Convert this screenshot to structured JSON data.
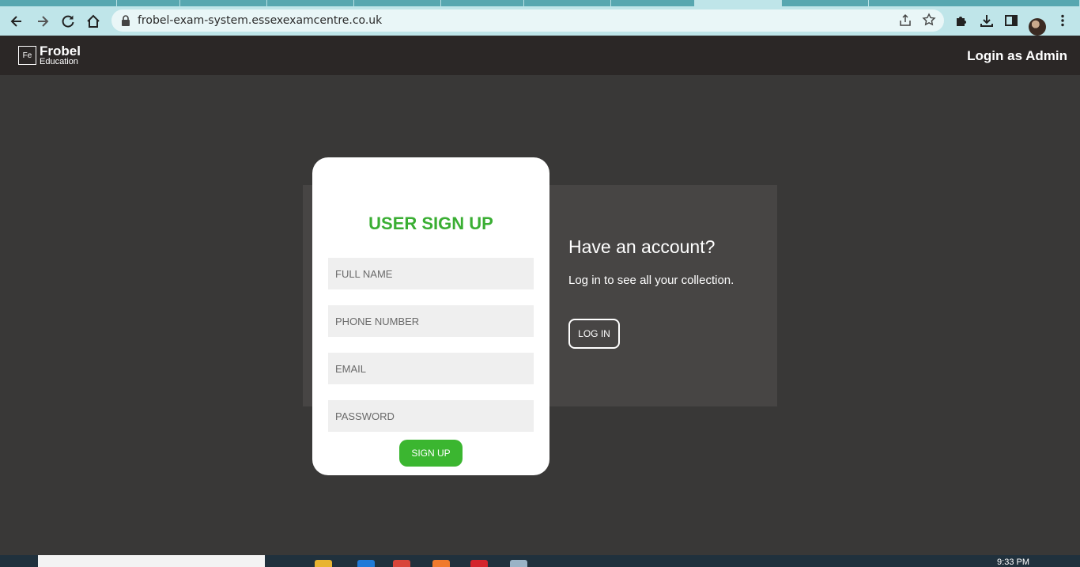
{
  "browser": {
    "url": "frobel-exam-system.essexexamcentre.co.uk"
  },
  "header": {
    "logo_box": "Fe",
    "logo_name": "Frobel",
    "logo_sub": "Education",
    "admin_link": "Login as Admin"
  },
  "signup": {
    "title": "USER SIGN UP",
    "fields": [
      {
        "placeholder": "FULL NAME"
      },
      {
        "placeholder": "PHONE NUMBER"
      },
      {
        "placeholder": "EMAIL"
      },
      {
        "placeholder": "PASSWORD"
      }
    ],
    "button": "SIGN UP",
    "accent_color": "#3bb630"
  },
  "login_panel": {
    "heading": "Have an account?",
    "text": "Log in to see all your collection.",
    "button": "LOG IN"
  },
  "taskbar": {
    "time": "9:33 PM"
  }
}
